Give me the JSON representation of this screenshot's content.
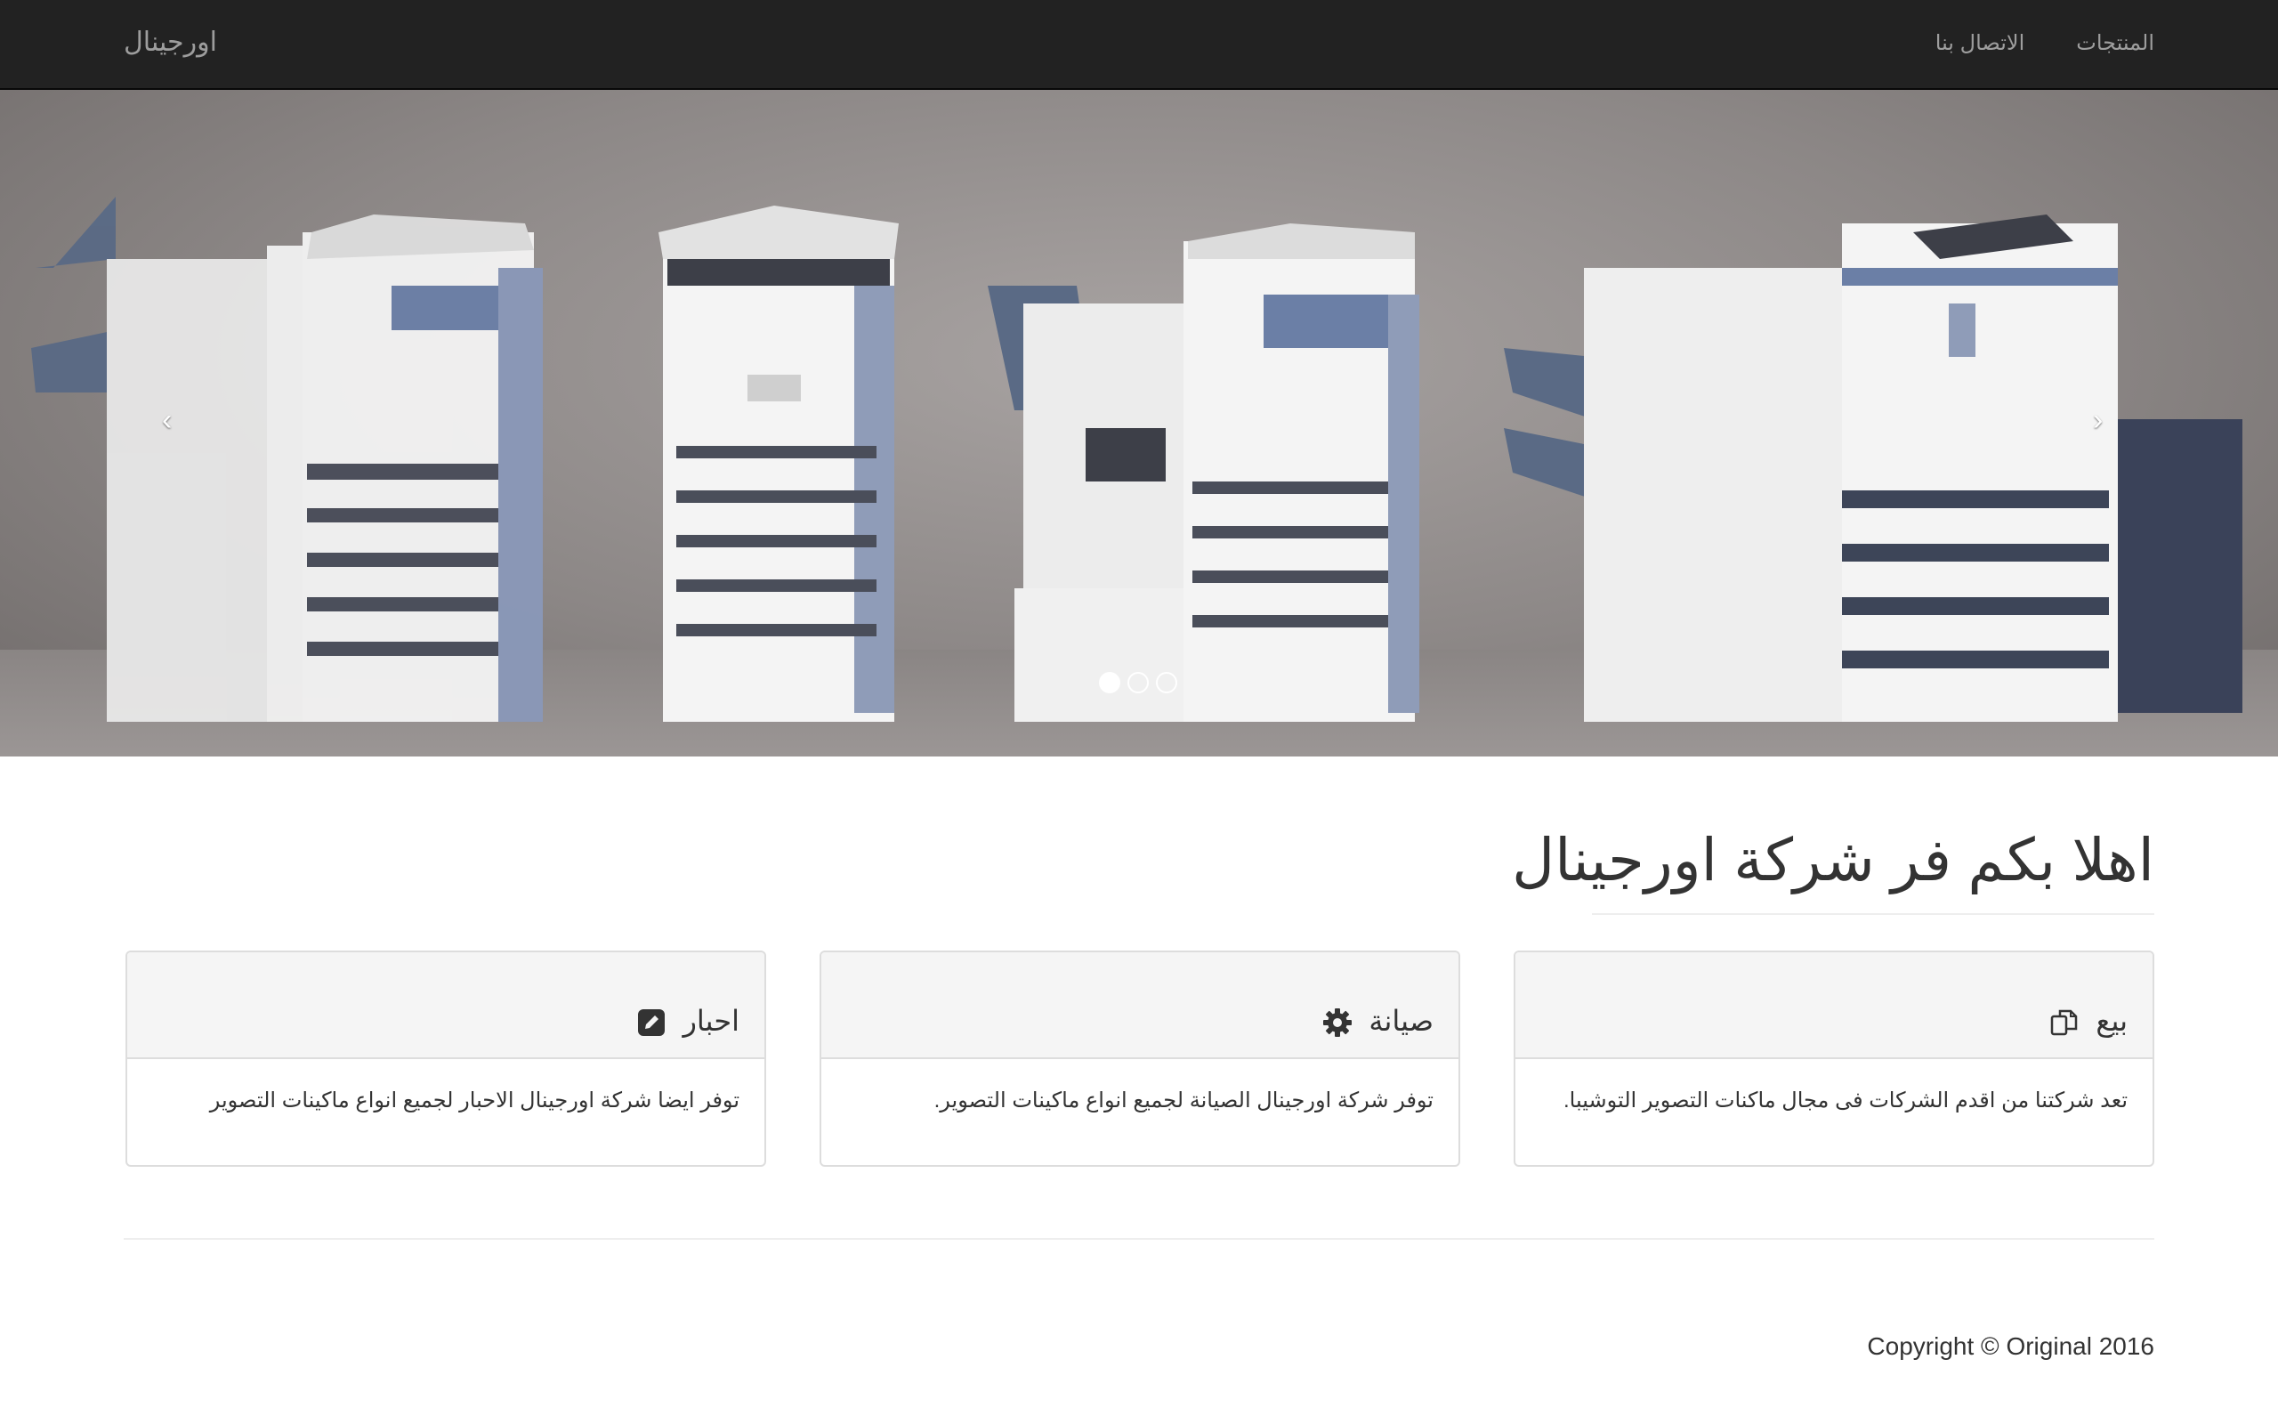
{
  "navbar": {
    "brand": "اورجينال",
    "links": [
      "المنتجات",
      "الاتصال بنا"
    ]
  },
  "carousel": {
    "prev_icon": "chevron-left-icon",
    "next_icon": "chevron-right-icon",
    "slide_count": 3,
    "active_slide": 1
  },
  "page": {
    "title": "اهلا بكم فر شركة اورجينال"
  },
  "panels": [
    {
      "title": "بيع",
      "icon": "copy-icon",
      "body": "تعد شركتنا من اقدم الشركات فى مجال ماكنات التصوير التوشيبا."
    },
    {
      "title": "صيانة",
      "icon": "gear-icon",
      "body": "توفر شركة اورجينال الصيانة لجميع انواع ماكينات التصوير."
    },
    {
      "title": "احبار",
      "icon": "edit-icon",
      "body": "توفر ايضا شركة اورجينال الاحبار لجميع انواع ماكينات التصوير"
    }
  ],
  "footer": {
    "copyright": "Copyright © Original 2016"
  },
  "colors": {
    "navbar_bg": "#222222",
    "navbar_text": "#9d9d9d",
    "panel_header_bg": "#f5f5f5",
    "panel_border": "#dddddd"
  }
}
